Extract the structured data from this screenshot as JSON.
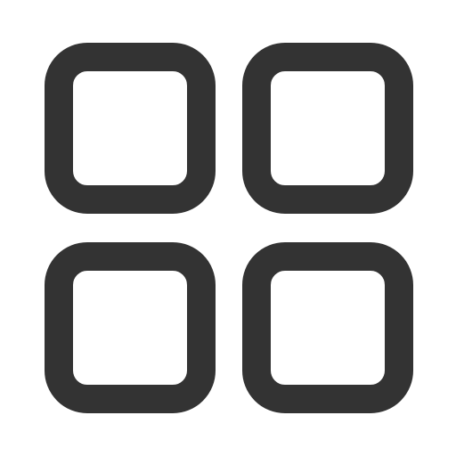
{
  "icon": {
    "name": "grid-icon",
    "stroke_color": "#333333",
    "fill_color": "#ffffff"
  }
}
